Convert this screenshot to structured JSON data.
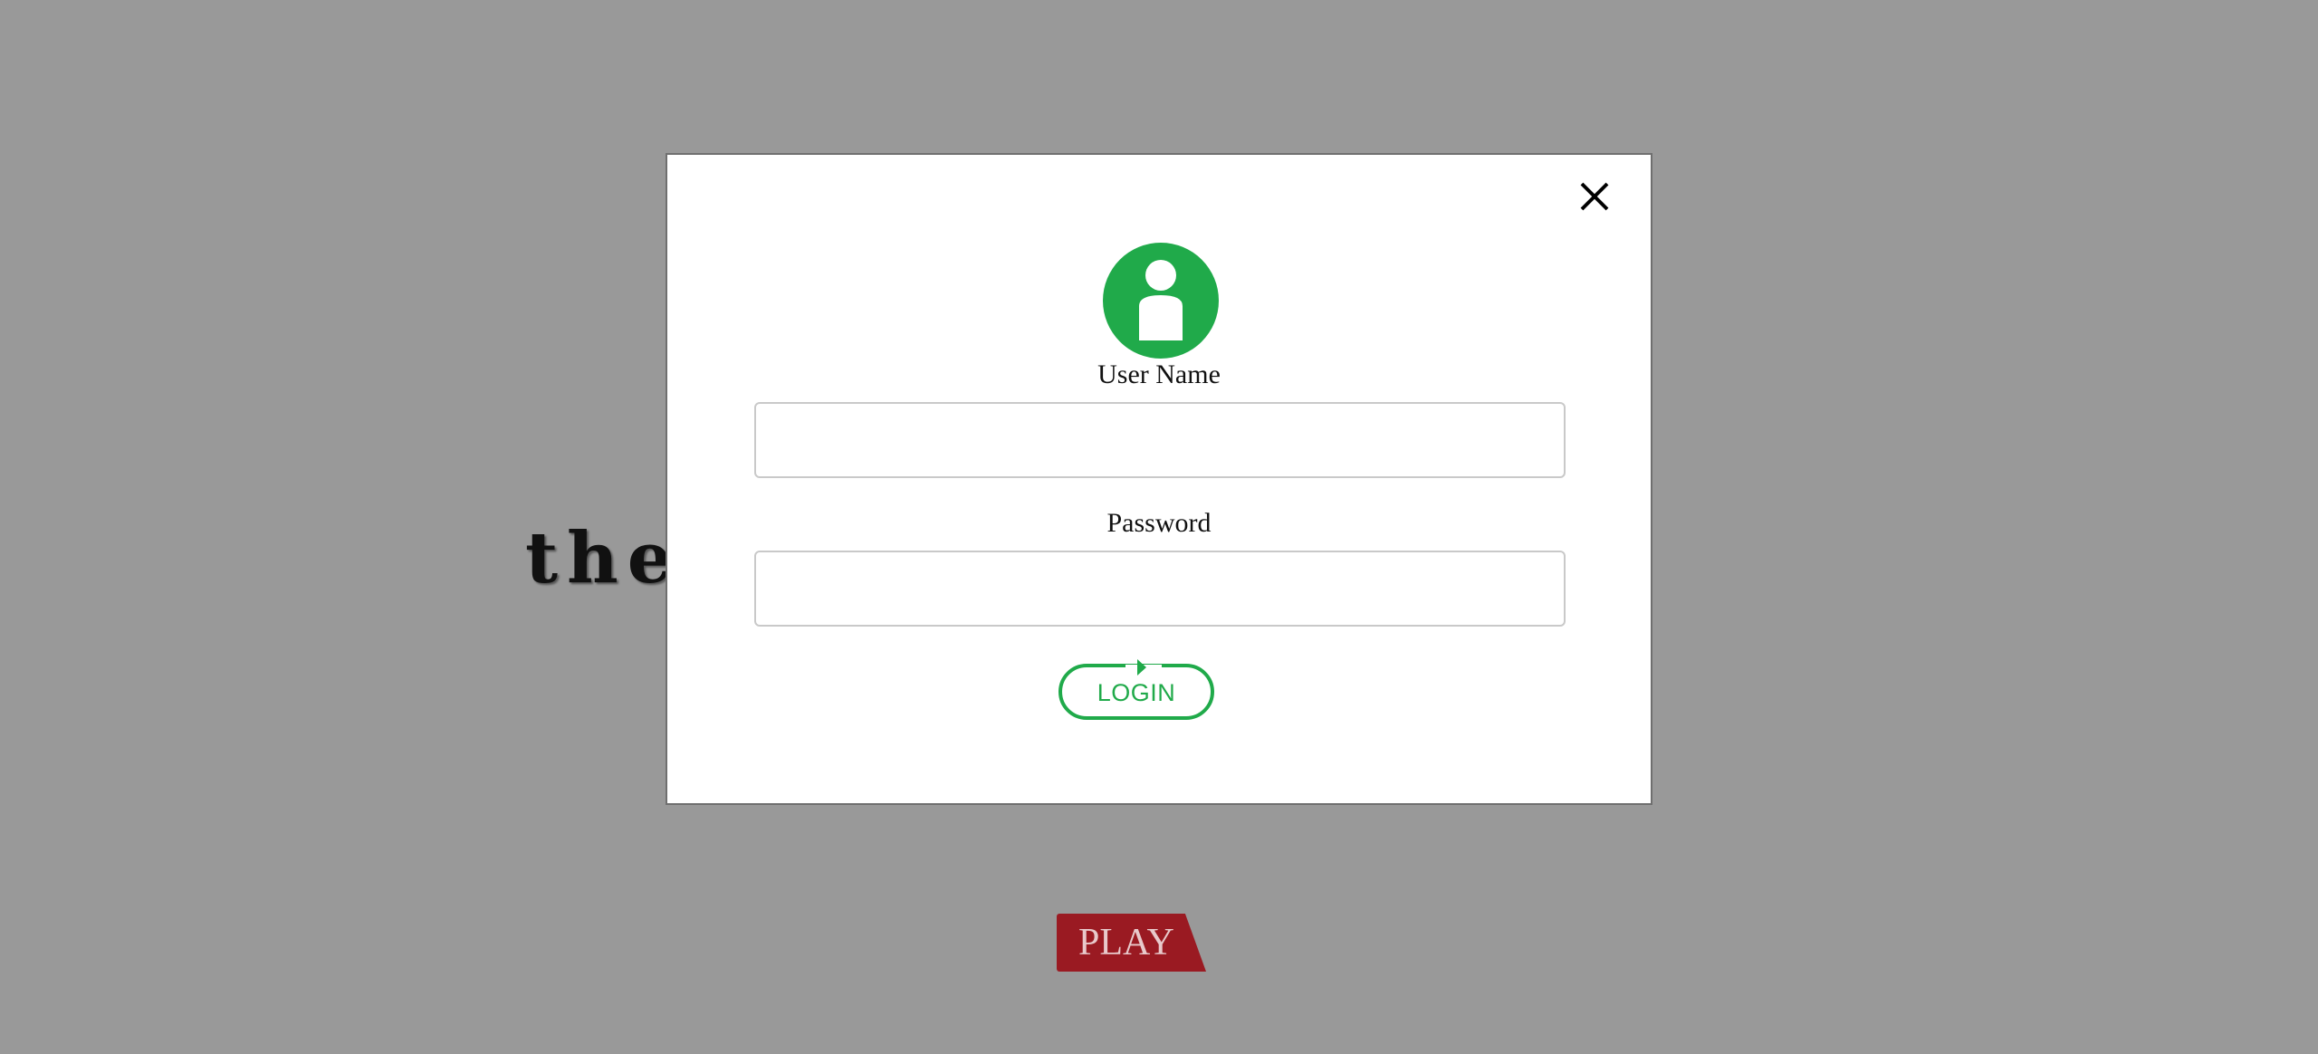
{
  "backdrop": {
    "title": "the",
    "play_label": "PLAY"
  },
  "modal": {
    "close_icon": "close-icon",
    "avatar_icon": "user-icon",
    "username_label": "User Name",
    "username_value": "",
    "password_label": "Password",
    "password_value": "",
    "login_label": "LOGIN",
    "login_icon": "arrow-right-icon"
  },
  "colors": {
    "overlay": "#999999",
    "accent_green": "#20aa4a",
    "play_red": "#9a1a22"
  }
}
